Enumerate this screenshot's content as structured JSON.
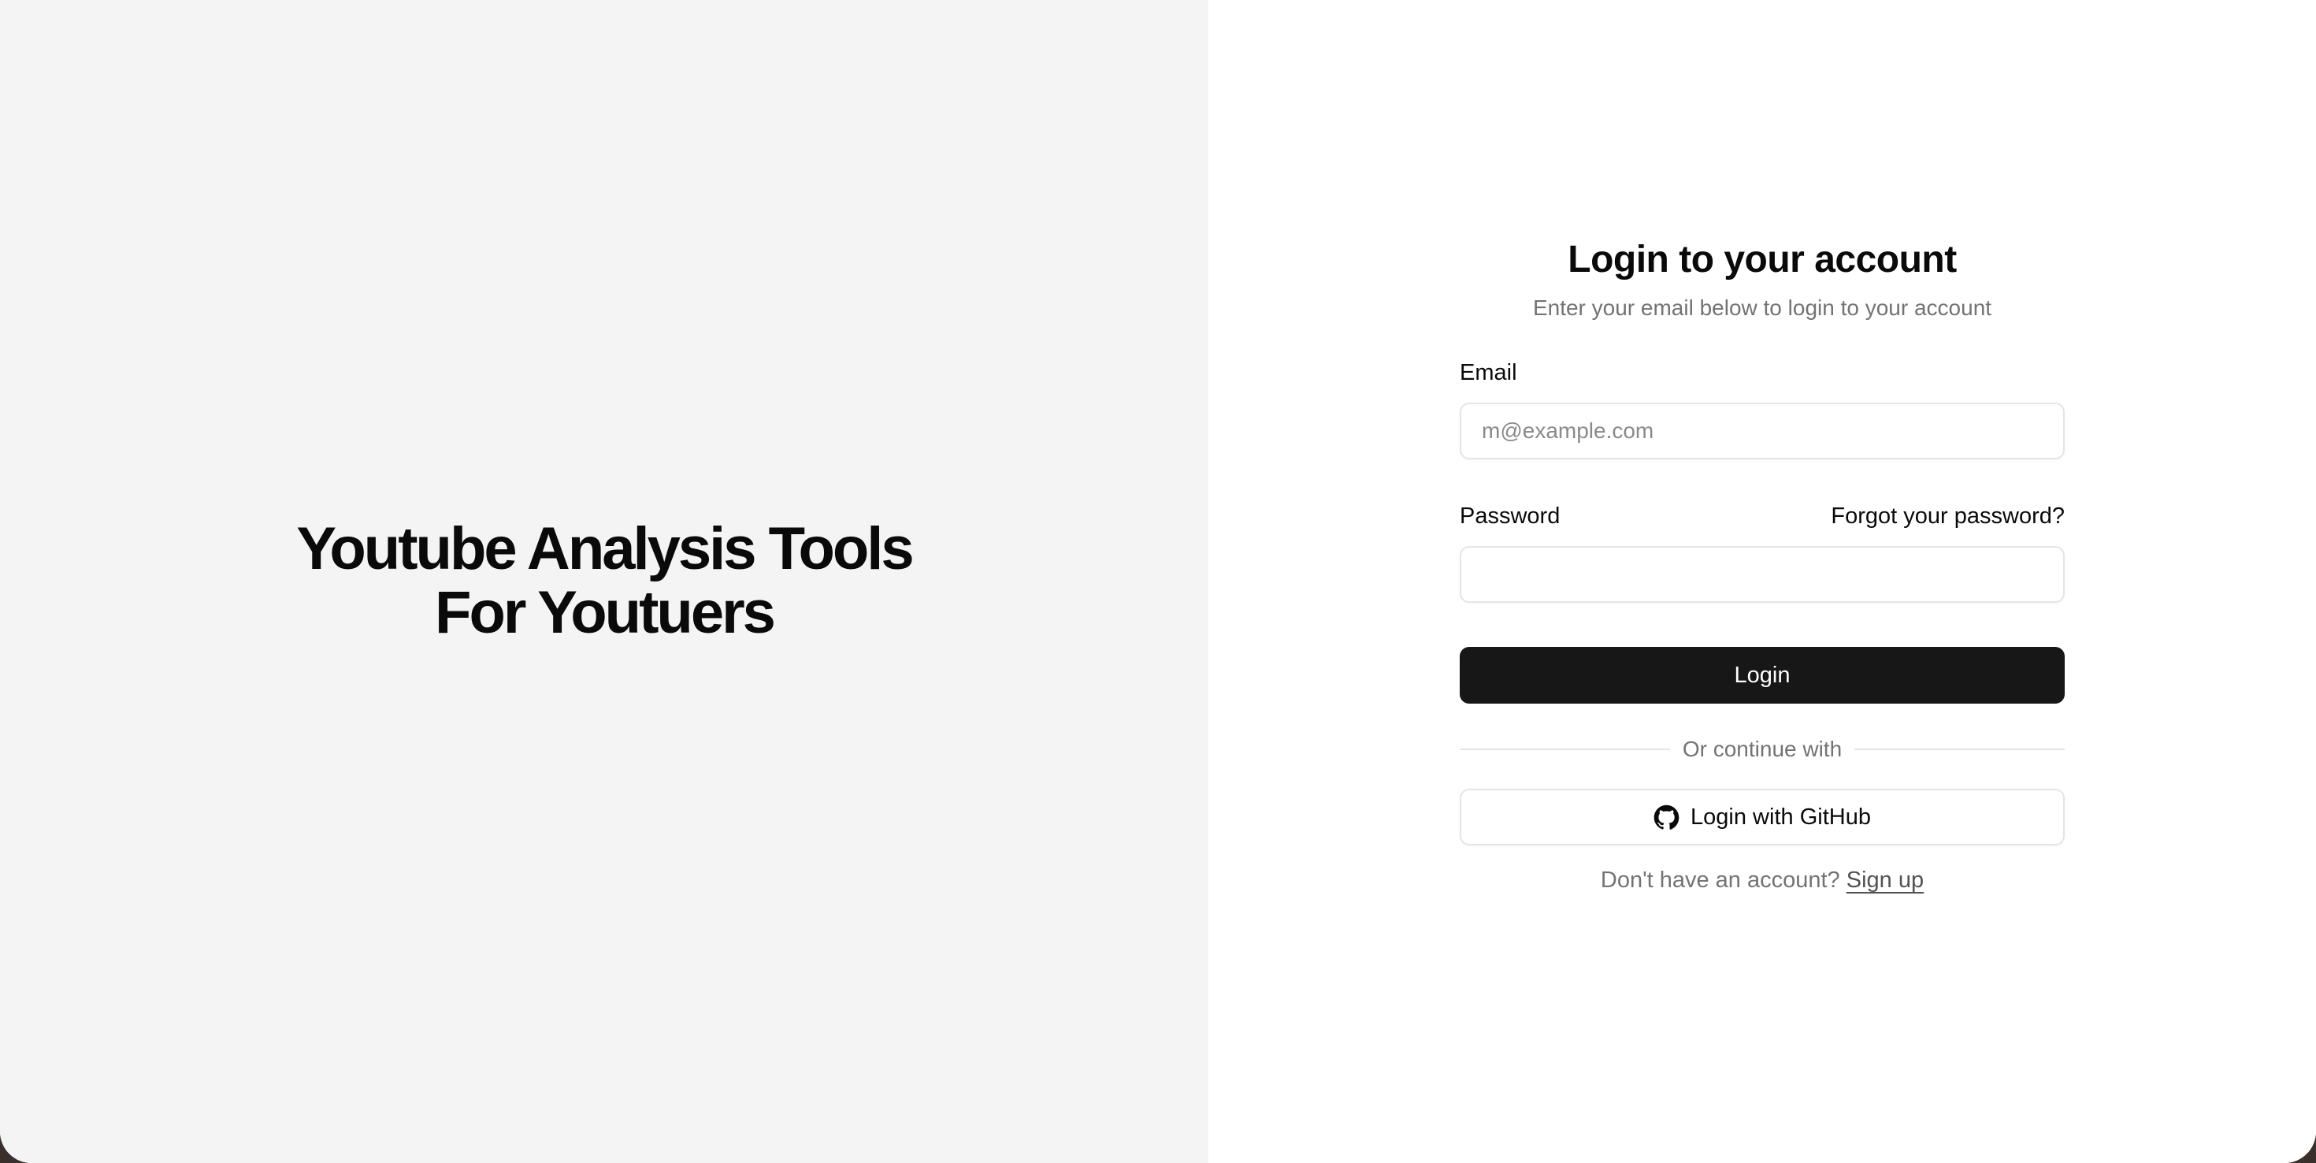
{
  "hero": {
    "title_line1": "Youtube Analysis Tools",
    "title_line2": "For Youtuers"
  },
  "login": {
    "title": "Login to your account",
    "subtitle": "Enter your email below to login to your account",
    "email_label": "Email",
    "email_placeholder": "m@example.com",
    "email_value": "",
    "password_label": "Password",
    "forgot_link": "Forgot your password?",
    "password_value": "",
    "submit_label": "Login",
    "divider_text": "Or continue with",
    "github_label": "Login with GitHub",
    "github_icon": "github-icon",
    "signup_prompt": "Don't have an account?",
    "signup_link": "Sign up"
  },
  "colors": {
    "left_panel_bg": "#f4f4f4",
    "primary_button_bg": "#171717",
    "muted_text": "#737373",
    "border": "#e5e5e5"
  }
}
